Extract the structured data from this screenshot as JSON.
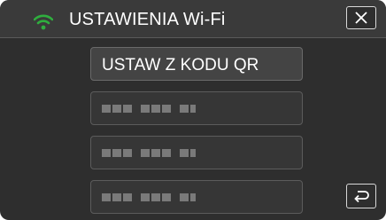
{
  "header": {
    "title": "USTAWIENIA Wi-Fi",
    "icon": "wifi-icon",
    "close_icon": "close-icon"
  },
  "menu": {
    "items": [
      {
        "label": "USTAW Z KODU QR",
        "state": "enabled"
      },
      {
        "label": "",
        "state": "masked",
        "icon": "masked-text-placeholder"
      },
      {
        "label": "",
        "state": "masked",
        "icon": "masked-text-placeholder"
      },
      {
        "label": "",
        "state": "masked",
        "icon": "masked-text-placeholder"
      }
    ]
  },
  "footer": {
    "back_icon": "return-arrow-icon"
  },
  "colors": {
    "background": "#2e2e2e",
    "header": "#3a3a3a",
    "wifi": "#2fae3e",
    "text": "#ffffff",
    "border": "#d8d8d8"
  }
}
